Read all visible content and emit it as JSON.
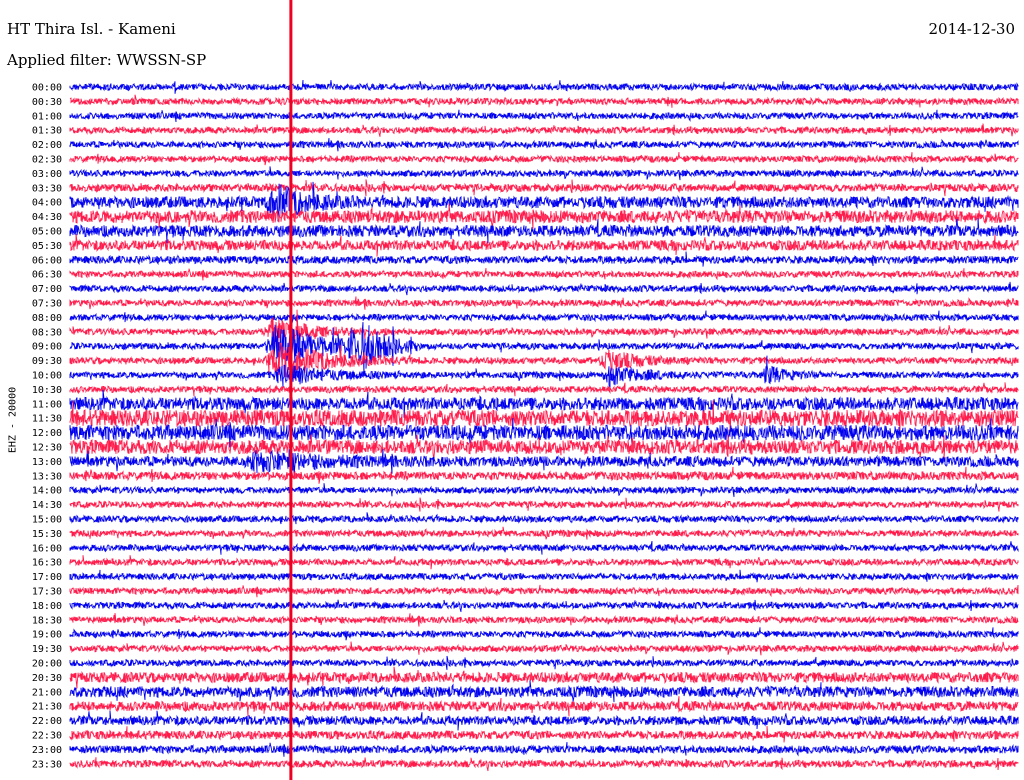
{
  "header": {
    "station": "HT Thira Isl. - Kameni",
    "filter": "Applied filter: WWSSN-SP",
    "date": "2014-12-30",
    "channel": "EHZ - 20000"
  },
  "colors": {
    "trace_odd": "#0000ee",
    "trace_even": "#ff1a4a",
    "marker": "#ee0022"
  },
  "chart_data": {
    "type": "line",
    "title": "HT Thira Isl. - Kameni",
    "subtitle": "Applied filter: WWSSN-SP",
    "ylabel": "EHZ - 20000",
    "categories": [
      "00:00",
      "00:30",
      "01:00",
      "01:30",
      "02:00",
      "02:30",
      "03:00",
      "03:30",
      "04:00",
      "04:30",
      "05:00",
      "05:30",
      "06:00",
      "06:30",
      "07:00",
      "07:30",
      "08:00",
      "08:30",
      "09:00",
      "09:30",
      "10:00",
      "10:30",
      "11:00",
      "11:30",
      "12:00",
      "12:30",
      "13:00",
      "13:30",
      "14:00",
      "14:30",
      "15:00",
      "15:30",
      "16:00",
      "16:30",
      "17:00",
      "17:30",
      "18:00",
      "18:30",
      "19:00",
      "19:30",
      "20:00",
      "20:30",
      "21:00",
      "21:30",
      "22:00",
      "22:30",
      "23:00",
      "23:30"
    ],
    "noise_level": [
      1.0,
      1.0,
      1.0,
      1.0,
      1.0,
      1.0,
      1.0,
      1.2,
      1.8,
      2.0,
      1.8,
      1.6,
      1.2,
      1.0,
      1.0,
      1.0,
      1.0,
      1.0,
      1.0,
      1.0,
      1.0,
      1.0,
      2.0,
      2.6,
      2.4,
      2.2,
      1.6,
      1.3,
      1.0,
      1.0,
      1.0,
      1.0,
      1.0,
      1.0,
      1.0,
      1.0,
      1.0,
      1.0,
      1.0,
      1.0,
      1.0,
      1.6,
      1.7,
      1.5,
      1.4,
      1.3,
      1.2,
      1.1
    ],
    "events": [
      {
        "row": 8,
        "pos": 0.215,
        "amp": 5.0,
        "dur": 0.03
      },
      {
        "row": 17,
        "pos": 0.215,
        "amp": 4.0,
        "dur": 0.04
      },
      {
        "row": 18,
        "pos": 0.22,
        "amp": 6.0,
        "dur": 0.05
      },
      {
        "row": 19,
        "pos": 0.22,
        "amp": 5.0,
        "dur": 0.05
      },
      {
        "row": 20,
        "pos": 0.225,
        "amp": 3.0,
        "dur": 0.04
      },
      {
        "row": 18,
        "pos": 0.297,
        "amp": 4.0,
        "dur": 0.02
      },
      {
        "row": 18,
        "pos": 0.31,
        "amp": 4.0,
        "dur": 0.02
      },
      {
        "row": 19,
        "pos": 0.565,
        "amp": 3.0,
        "dur": 0.03
      },
      {
        "row": 20,
        "pos": 0.57,
        "amp": 3.0,
        "dur": 0.03
      },
      {
        "row": 20,
        "pos": 0.735,
        "amp": 2.5,
        "dur": 0.02
      },
      {
        "row": 26,
        "pos": 0.2,
        "amp": 2.5,
        "dur": 0.06
      }
    ],
    "marker_position": 0.233
  }
}
